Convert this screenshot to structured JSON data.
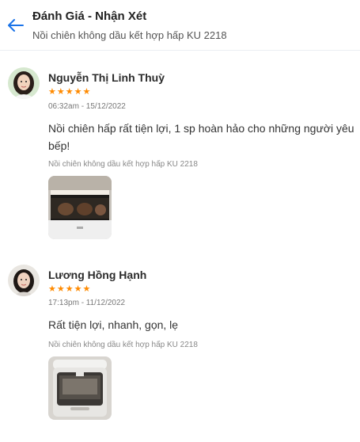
{
  "header": {
    "back_icon": "arrow-left-icon",
    "title": "Đánh Giá - Nhận Xét",
    "subtitle": "Nồi chiên không dầu kết hợp hấp KU 2218"
  },
  "accent_color": "#1a73e8",
  "star_color": "#ff8a00",
  "reviews": [
    {
      "author": "Nguyễn Thị Linh Thuỳ",
      "rating": 5,
      "time": "06:32am - 15/12/2022",
      "content": "Nồi chiên hấp rất tiện lợi, 1 sp hoàn hảo cho những người yêu bếp!",
      "product": "Nồi chiên không dầu kết hợp hấp KU 2218"
    },
    {
      "author": "Lương Hồng Hạnh",
      "rating": 5,
      "time": "17:13pm - 11/12/2022",
      "content": "Rất tiện lợi, nhanh, gọn, lẹ",
      "product": "Nồi chiên không dầu kết hợp hấp KU 2218"
    }
  ]
}
